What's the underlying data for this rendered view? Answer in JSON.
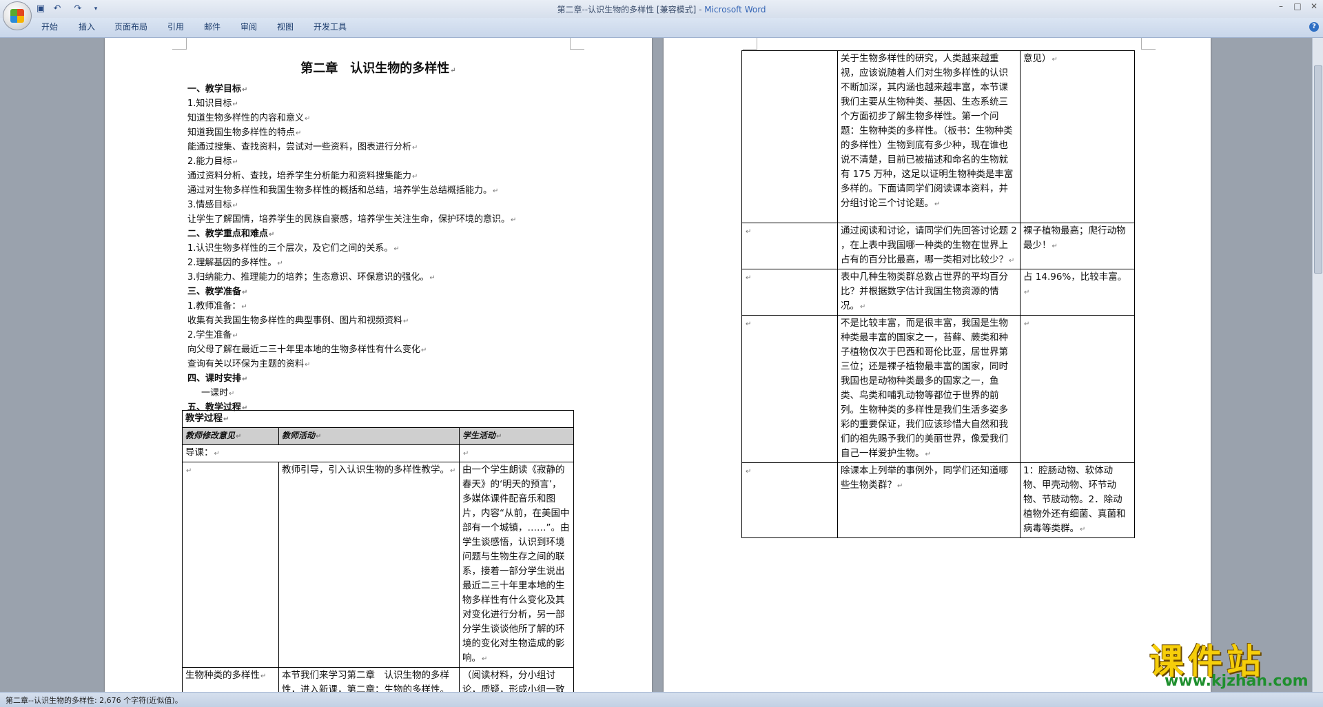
{
  "window": {
    "title": "第二章--认识生物的多样性 [兼容模式] - ",
    "app_name": "Microsoft Word"
  },
  "ribbon": {
    "tabs": [
      "开始",
      "插入",
      "页面布局",
      "引用",
      "邮件",
      "审阅",
      "视图",
      "开发工具"
    ]
  },
  "page1": {
    "title": "第二章　认识生物的多样性",
    "lines": [
      {
        "text": "一、教学目标",
        "bold": true
      },
      {
        "text": "1.知识目标",
        "bold": false
      },
      {
        "text": "知道生物多样性的内容和意义",
        "bold": false
      },
      {
        "text": "知道我国生物多样性的特点",
        "bold": false
      },
      {
        "text": "能通过搜集、查找资料，尝试对一些资料，图表进行分析",
        "bold": false
      },
      {
        "text": "2.能力目标",
        "bold": false
      },
      {
        "text": "通过资料分析、查找，培养学生分析能力和资料搜集能力",
        "bold": false
      },
      {
        "text": "通过对生物多样性和我国生物多样性的概括和总结，培养学生总结概括能力。",
        "bold": false
      },
      {
        "text": "3.情感目标",
        "bold": false
      },
      {
        "text": "让学生了解国情，培养学生的民族自豪感，培养学生关注生命，保护环境的意识。",
        "bold": false
      },
      {
        "text": "二、教学重点和难点",
        "bold": true
      },
      {
        "text": "1.认识生物多样性的三个层次，及它们之间的关系。",
        "bold": false
      },
      {
        "text": "2.理解基因的多样性。",
        "bold": false
      },
      {
        "text": "3.归纳能力、推理能力的培养；生态意识、环保意识的强化。",
        "bold": false
      },
      {
        "text": "三、教学准备",
        "bold": true
      },
      {
        "text": "1.教师准备：",
        "bold": false
      },
      {
        "text": "收集有关我国生物多样性的典型事例、图片和视频资料",
        "bold": false
      },
      {
        "text": "2.学生准备",
        "bold": false
      },
      {
        "text": "向父母了解在最近二三十年里本地的生物多样性有什么变化",
        "bold": false
      },
      {
        "text": "查询有关以环保为主题的资料",
        "bold": false
      },
      {
        "text": "四、课时安排",
        "bold": true
      },
      {
        "text": "一课时",
        "bold": false,
        "indent": true
      },
      {
        "text": "五、教学过程",
        "bold": true
      }
    ],
    "table": {
      "caption": "教学过程",
      "headers": [
        "教师修改意见",
        "教师活动",
        "学生活动"
      ],
      "rows": [
        [
          "导课：",
          "",
          ""
        ],
        [
          "",
          "教师引导，引入认识生物的多样性教学。",
          "由一个学生朗读《寂静的春天》的‘明天的预言’，多媒体课件配音乐和图片，内容“从前，在美国中部有一个城镇，……”。由学生谈感悟，认识到环境问题与生物生存之间的联系，接着一部分学生说出最近二三十年里本地的生物多样性有什么变化及其对变化进行分析，另一部分学生谈谈他所了解的环境的变化对生物造成的影响。"
        ],
        [
          "生物种类的多样性",
          "本节我们来学习第二章　认识生物的多样性，进入新课，第二章：生物的多样性。",
          "（阅读材料，分小组讨论，质疑，形成小组一致"
        ]
      ]
    }
  },
  "page2": {
    "table": {
      "rows": [
        [
          "",
          "关于生物多样性的研究，人类越来越重视，应该说随着人们对生物多样性的认识不断加深，其内涵也越来越丰富，本节课我们主要从生物种类、基因、生态系统三个方面初步了解生物多样性。第一个问题：生物种类的多样性。（板书：生物种类的多样性）生物到底有多少种，现在谁也说不清楚，目前已被描述和命名的生物就有 175 万种，这足以证明生物种类是丰富多样的。下面请同学们阅读课本资料，并分组讨论三个讨论题。",
          "意见）"
        ],
        [
          "",
          "通过阅读和讨论，请同学们先回答讨论题 2 ，在上表中我国哪一种类的生物在世界上占有的百分比最高，哪一类相对比较少？",
          "裸子植物最高；爬行动物最少！"
        ],
        [
          "",
          "表中几种生物类群总数占世界的平均百分比？并根据数字估计我国生物资源的情况。",
          "占 14.96%，比较丰富。"
        ],
        [
          "",
          "不是比较丰富，而是很丰富，我国是生物种类最丰富的国家之一，苔藓、蕨类和种子植物仅次于巴西和哥伦比亚，居世界第三位；还是裸子植物最丰富的国家，同时我国也是动物种类最多的国家之一，鱼类、鸟类和哺乳动物等都位于世界的前列。生物种类的多样性是我们生活多姿多彩的重要保证，我们应该珍惜大自然和我们的祖先赐予我们的美丽世界，像爱我们自己一样爱护生物。",
          ""
        ],
        [
          "",
          "除课本上列举的事例外，同学们还知道哪些生物类群？",
          "1：腔肠动物、软体动物、甲壳动物、环节动物、节肢动物。2．除动植物外还有细菌、真菌和病毒等类群。"
        ]
      ]
    }
  },
  "status": {
    "text": "第二章--认识生物的多样性: 2,676 个字符(近似值)。"
  },
  "watermark": {
    "cn": "课件站",
    "url": "www.kjzhan.com"
  },
  "icons": {
    "save": "save-icon",
    "undo": "undo-icon",
    "redo": "redo-icon",
    "help": "help-icon"
  }
}
